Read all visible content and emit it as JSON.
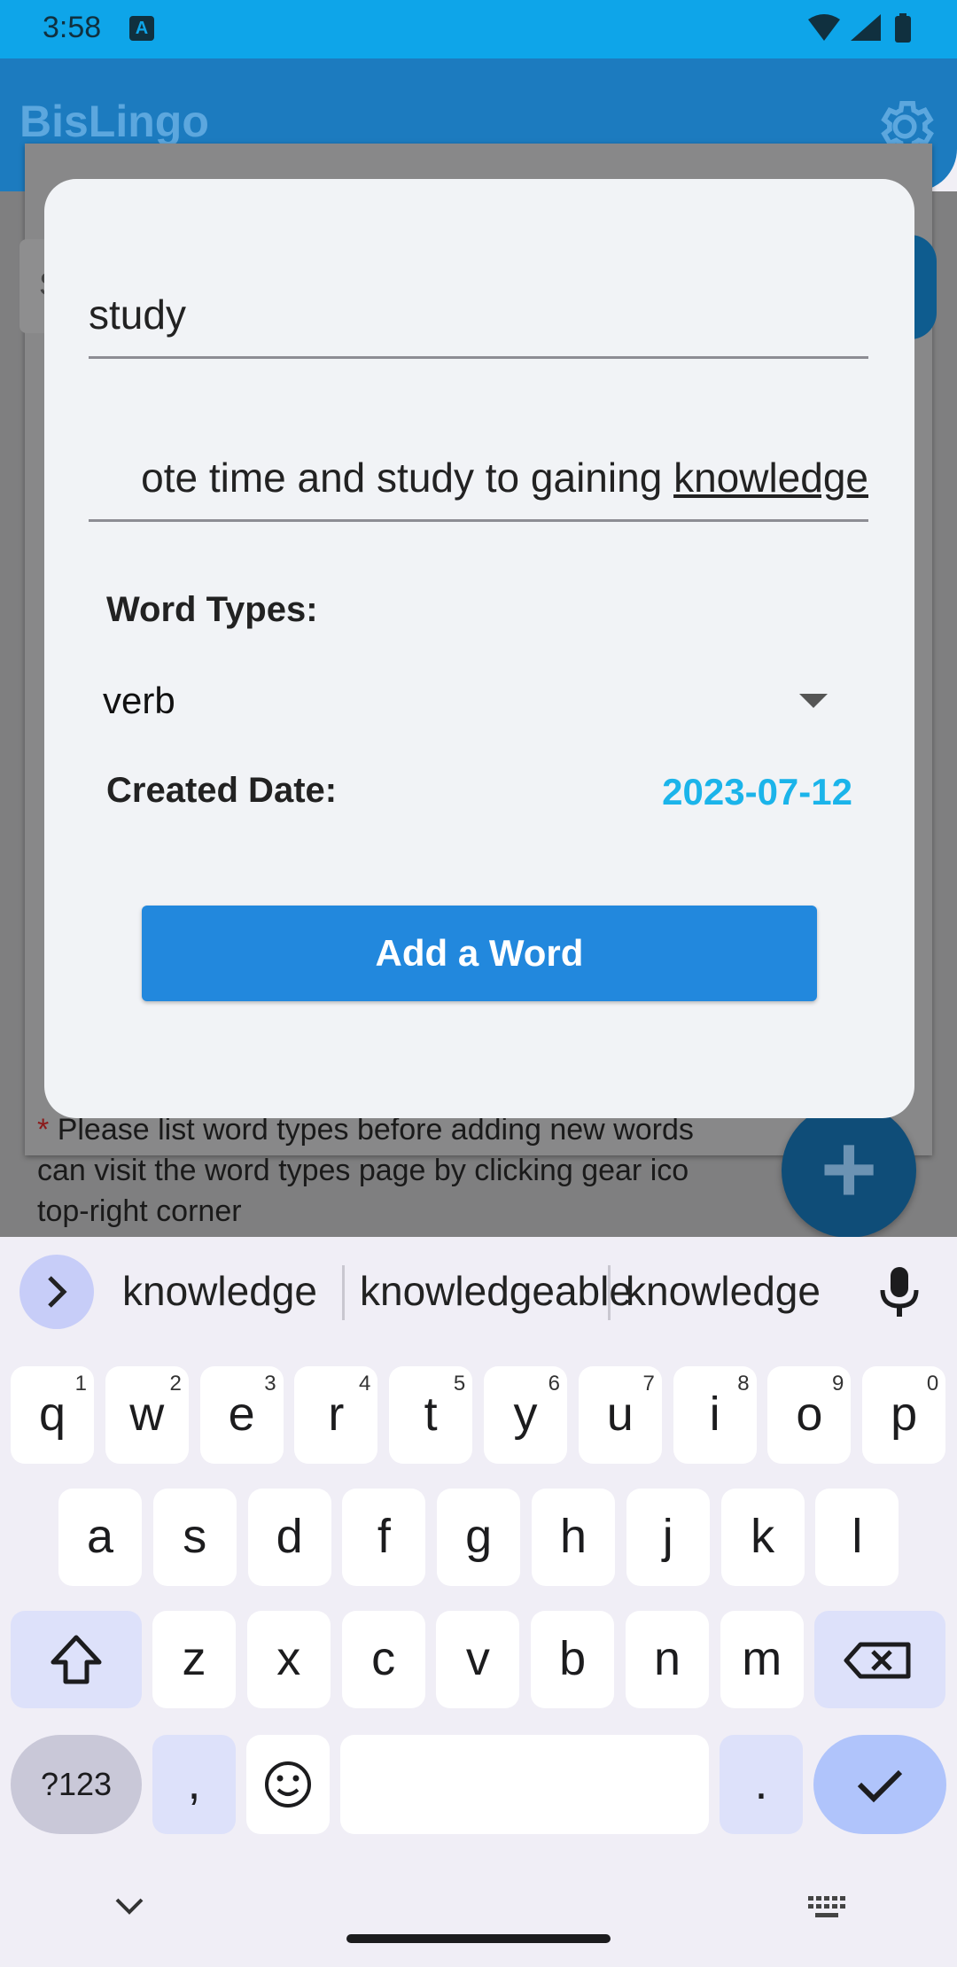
{
  "status_bar": {
    "time": "3:58",
    "notification_glyph": "A"
  },
  "app": {
    "title": "BisLingo"
  },
  "background": {
    "search_initial": "S",
    "button_fragment": "s",
    "note_star": "*",
    "note_lines": [
      "Please list word types before adding new words",
      "can visit the word types page by clicking gear ico",
      "top-right corner"
    ],
    "fab_symbol": "+"
  },
  "dialog": {
    "word_value": "study",
    "definition_prefix": "ote time and study to gaining ",
    "definition_underlined": "knowledge",
    "word_types_label": "Word Types:",
    "word_type_selected": "verb",
    "created_date_label": "Created Date:",
    "created_date_value": "2023-07-12",
    "add_button_label": "Add a Word"
  },
  "keyboard": {
    "suggestions": [
      "knowledge",
      "knowledgeable",
      "knowledge l"
    ],
    "row1": [
      {
        "ch": "q",
        "sup": "1"
      },
      {
        "ch": "w",
        "sup": "2"
      },
      {
        "ch": "e",
        "sup": "3"
      },
      {
        "ch": "r",
        "sup": "4"
      },
      {
        "ch": "t",
        "sup": "5"
      },
      {
        "ch": "y",
        "sup": "6"
      },
      {
        "ch": "u",
        "sup": "7"
      },
      {
        "ch": "i",
        "sup": "8"
      },
      {
        "ch": "o",
        "sup": "9"
      },
      {
        "ch": "p",
        "sup": "0"
      }
    ],
    "row2": [
      "a",
      "s",
      "d",
      "f",
      "g",
      "h",
      "j",
      "k",
      "l"
    ],
    "row3": [
      "z",
      "x",
      "c",
      "v",
      "b",
      "n",
      "m"
    ],
    "symbols_label": "?123",
    "comma": ",",
    "period": "."
  },
  "colors": {
    "status_bar": "#0ea5e9",
    "accent_date": "#1bb4ea",
    "primary_button": "#2288dd"
  }
}
